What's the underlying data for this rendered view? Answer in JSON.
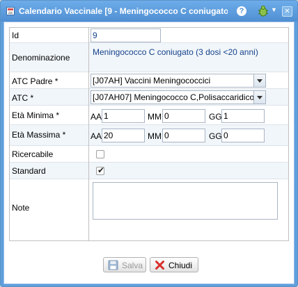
{
  "window": {
    "title": "Calendario Vaccinale [9 - Meningococco C coniugato...",
    "help_glyph": "?",
    "close_glyph": "✕"
  },
  "form": {
    "id_label": "Id",
    "id_value": "9",
    "denominazione_label": "Denominazione",
    "denominazione_value": "Meningococco C coniugato (3 dosi <20 anni)",
    "atc_padre_label": "ATC Padre *",
    "atc_padre_value": "[J07AH] Vaccini Meningococcici",
    "atc_label": "ATC *",
    "atc_value": "[J07AH07] Meningococco C,Polisaccaridico",
    "eta_minima_label": "Età Minima *",
    "eta_massima_label": "Età Massima *",
    "aa_label": "AA",
    "mm_label": "MM",
    "gg_label": "GG",
    "eta_minima": {
      "aa": "1",
      "mm": "0",
      "gg": "1"
    },
    "eta_massima": {
      "aa": "20",
      "mm": "0",
      "gg": "0"
    },
    "ricercabile_label": "Ricercabile",
    "ricercabile_checked": false,
    "standard_label": "Standard",
    "standard_checked": true,
    "standard_check_glyph": "✔",
    "note_label": "Note",
    "note_value": ""
  },
  "buttons": {
    "salva_label": "Salva",
    "chiudi_label": "Chiudi"
  },
  "colors": {
    "titlebar": "#4f8fd2",
    "value_text": "#15428b",
    "alt_row": "#f1f6fa"
  }
}
